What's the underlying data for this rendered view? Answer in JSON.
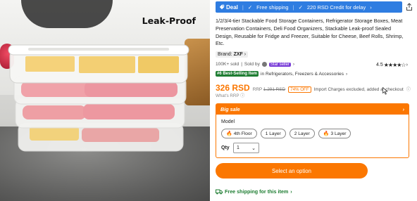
{
  "photo": {
    "overlay_text": "Leak-Proof"
  },
  "deal_bar": {
    "deal_label": "Deal",
    "free_shipping": "Free shipping",
    "credit": "220 RSD Credit for delay",
    "color": "#2f7de1"
  },
  "product": {
    "title": "1/2/3/4-tier Stackable Food Storage Containers, Refrigerator Storage Boxes, Meat Preservation Containers, Deli Food Organizers, Stackable Leak-proof Sealed Design, Reusable for Fridge and Freezer, Suitable for Cheese, Beef Rolls, Shrimp, Etc.",
    "brand_label": "Brand:",
    "brand": "ZXF",
    "sold_text": "100K+ sold",
    "sold_by": "Sold by",
    "star_seller": "Star seller",
    "rating": "4.5",
    "stars": "★★★★☆",
    "best_selling_badge": "#6 Best-Selling Item",
    "best_selling_category": "in Refrigerators, Freezers & Accessories"
  },
  "price": {
    "current": "326 RSD",
    "rrp_label": "RRP",
    "rrp": "1.291 RSD",
    "discount": "74% OFF",
    "import_note": "Import Charges excluded, added at checkout",
    "whats_rrp": "What's RRP",
    "accent": "#fb7701"
  },
  "big_sale": {
    "header": "Big sale",
    "model_label": "Model",
    "options": [
      {
        "label": "4th Floor",
        "hot": true
      },
      {
        "label": "1 Layer",
        "hot": false
      },
      {
        "label": "2 Layer",
        "hot": false
      },
      {
        "label": "3 Layer",
        "hot": true
      }
    ],
    "qty_label": "Qty",
    "qty_value": "1"
  },
  "cta": {
    "label": "Select an option"
  },
  "shipping": {
    "label": "Free shipping for this item"
  }
}
